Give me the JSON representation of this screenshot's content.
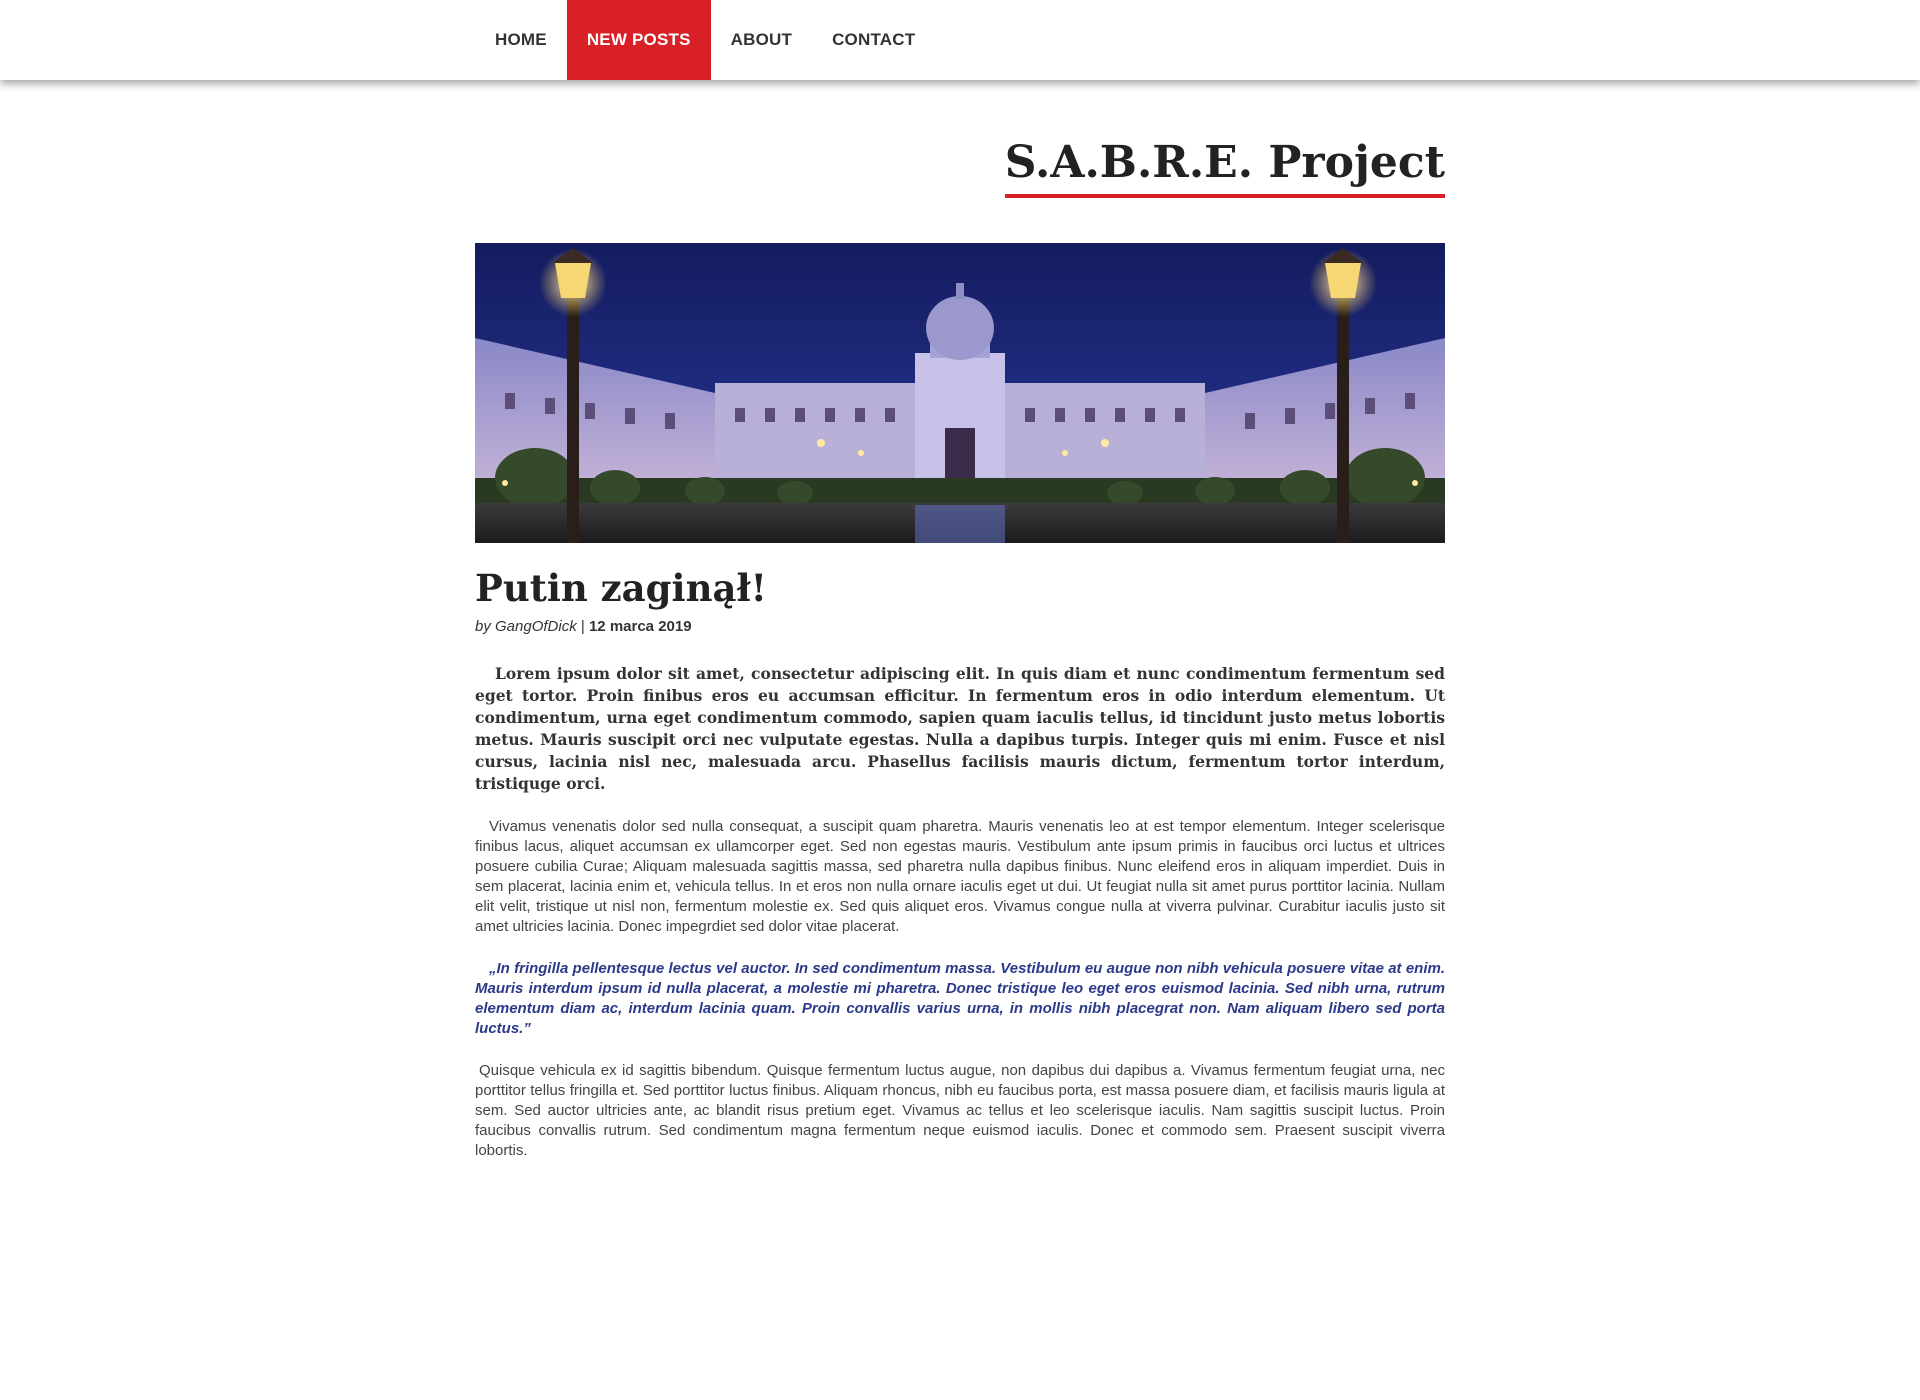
{
  "nav": {
    "items": [
      {
        "label": "HOME",
        "active": false
      },
      {
        "label": "NEW POSTS",
        "active": true
      },
      {
        "label": "ABOUT",
        "active": false
      },
      {
        "label": "CONTACT",
        "active": false
      }
    ]
  },
  "site": {
    "title": "S.A.B.R.E. Project",
    "accent_color": "#d92027"
  },
  "post": {
    "title": "Putin zaginął!",
    "by": "by GangOfDick",
    "separator": "|",
    "date": "12 marca 2019",
    "lead": "Lorem ipsum dolor sit amet, consectetur adipiscing elit. In quis diam et nunc condimentum fermentum sed eget tortor. Proin finibus eros eu accumsan efficitur. In fermentum eros in odio interdum elementum. Ut condimentum, urna eget condimentum commodo, sapien quam iaculis tellus, id tincidunt justo metus lobortis metus. Mauris suscipit orci nec vulputate egestas. Nulla a dapibus turpis. Integer quis mi enim. Fusce et nisl cursus, lacinia nisl nec, malesuada arcu. Phasellus facilisis mauris dictum, fermentum tortor interdum, tristiquge orci.",
    "body1": "Vivamus venenatis dolor sed nulla consequat, a suscipit quam pharetra. Mauris venenatis leo at est tempor elementum. Integer scelerisque finibus lacus, aliquet accumsan ex ullamcorper eget. Sed non egestas mauris. Vestibulum ante ipsum primis in faucibus orci luctus et ultrices posuere cubilia Curae; Aliquam malesuada sagittis massa, sed pharetra nulla dapibus finibus. Nunc eleifend eros in aliquam imperdiet. Duis in sem placerat, lacinia enim et, vehicula tellus. In et eros non nulla ornare iaculis eget ut dui. Ut feugiat nulla sit amet purus porttitor lacinia. Nullam elit velit, tristique ut nisl non, fermentum molestie ex. Sed quis aliquet eros. Vivamus congue nulla at viverra pulvinar. Curabitur iaculis justo sit amet ultricies lacinia. Donec impegrdiet sed dolor vitae placerat.",
    "quote": "„In fringilla pellentesque lectus vel auctor. In sed condimentum massa. Vestibulum eu augue non nibh vehicula posuere vitae at enim. Mauris interdum ipsum id nulla placerat, a molestie mi pharetra. Donec tristique leo eget eros euismod lacinia. Sed nibh urna, rutrum elementum diam ac, interdum lacinia quam. Proin convallis varius urna, in mollis nibh placegrat non. Nam aliquam libero sed porta luctus.”",
    "body2": "Quisque vehicula ex id sagittis bibendum. Quisque fermentum luctus augue, non dapibus dui dapibus a. Vivamus fermentum feugiat urna, nec porttitor tellus fringilla et. Sed porttitor luctus finibus. Aliquam rhoncus, nibh eu faucibus porta, est massa posuere diam, et facilisis mauris ligula at sem. Sed auctor ultricies ante, ac blandit risus pretium eget. Vivamus ac tellus et leo scelerisque iaculis. Nam sagittis suscipit luctus. Proin faucibus convallis rutrum. Sed condimentum magna fermentum neque euismod iaculis. Donec et commodo sem. Praesent suscipit viverra lobortis."
  }
}
